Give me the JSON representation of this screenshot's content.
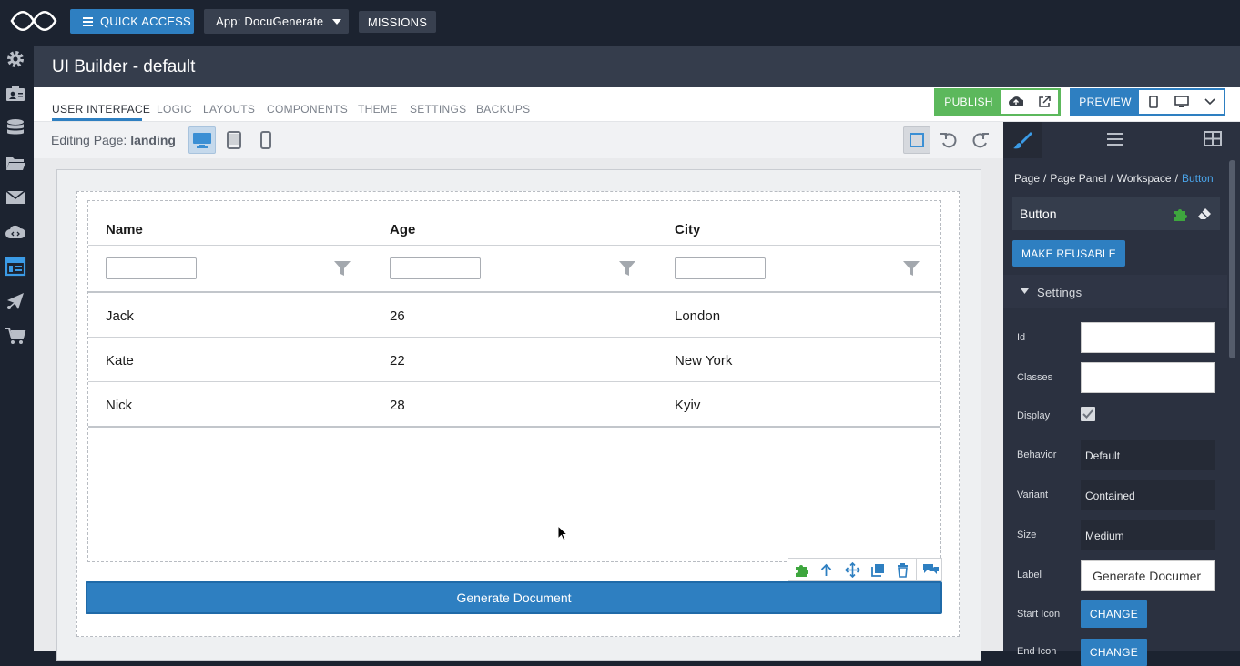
{
  "topbar": {
    "quick_access": "QUICK ACCESS",
    "app_select": "App: DocuGenerate",
    "missions": "MISSIONS"
  },
  "header": {
    "title": "UI Builder - default"
  },
  "tabs": [
    "USER INTERFACE",
    "LOGIC",
    "LAYOUTS",
    "COMPONENTS",
    "THEME",
    "SETTINGS",
    "BACKUPS"
  ],
  "actions": {
    "publish": "PUBLISH",
    "preview": "PREVIEW"
  },
  "editing": {
    "label": "Editing Page:",
    "page": "landing"
  },
  "table": {
    "headers": [
      "Name",
      "Age",
      "City"
    ],
    "rows": [
      [
        "Jack",
        "26",
        "London"
      ],
      [
        "Kate",
        "22",
        "New York"
      ],
      [
        "Nick",
        "28",
        "Kyiv"
      ]
    ]
  },
  "generate_button": "Generate Document",
  "panel": {
    "breadcrumb": [
      "Page",
      "Page Panel",
      "Workspace",
      "Button"
    ],
    "component": "Button",
    "make_reusable": "MAKE REUSABLE",
    "settings": "Settings",
    "props": {
      "id_label": "Id",
      "classes_label": "Classes",
      "display_label": "Display",
      "behavior_label": "Behavior",
      "behavior_value": "Default",
      "variant_label": "Variant",
      "variant_value": "Contained",
      "size_label": "Size",
      "size_value": "Medium",
      "label_label": "Label",
      "label_value": "Generate Documer",
      "start_icon_label": "Start Icon",
      "end_icon_label": "End Icon",
      "change": "CHANGE"
    }
  },
  "colors": {
    "accent": "#2e7fc1",
    "publish": "#5cb85c",
    "dark": "#1c2330",
    "panel": "#2b3140"
  }
}
